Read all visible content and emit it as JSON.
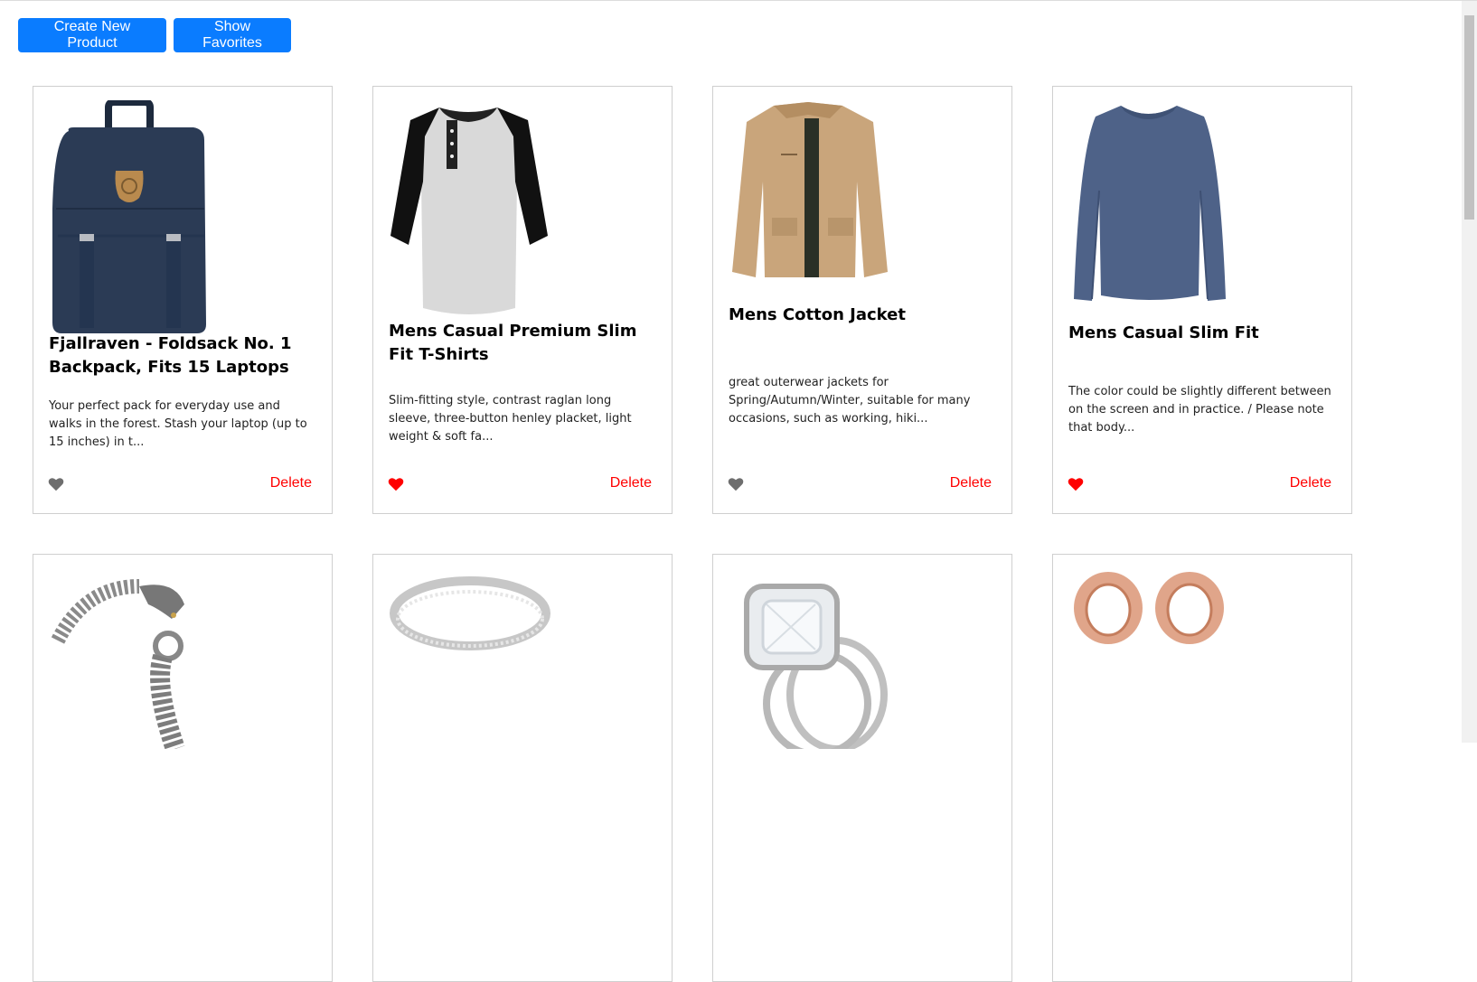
{
  "toolbar": {
    "create_label": "Create New Product",
    "favorites_label": "Show Favorites"
  },
  "colors": {
    "primary": "#0a7cff",
    "delete": "#ff0000",
    "favorite_on": "#ff0000",
    "favorite_off": "#6e6e6e"
  },
  "products": [
    {
      "title": "Fjallraven - Foldsack No. 1 Backpack, Fits 15 Laptops",
      "description": "Your perfect pack for everyday use and walks in the forest. Stash your laptop (up to 15 inches) in t...",
      "favorite": false,
      "delete_label": "Delete",
      "image_icon": "backpack-image"
    },
    {
      "title": "Mens Casual Premium Slim Fit T-Shirts",
      "description": "Slim-fitting style, contrast raglan long sleeve, three-button henley placket, light weight & soft fa...",
      "favorite": true,
      "delete_label": "Delete",
      "image_icon": "tshirt-image"
    },
    {
      "title": "Mens Cotton Jacket",
      "description": "great outerwear jackets for Spring/Autumn/Winter, suitable for many occasions, such as working, hiki...",
      "favorite": false,
      "delete_label": "Delete",
      "image_icon": "jacket-image"
    },
    {
      "title": "Mens Casual Slim Fit",
      "description": "The color could be slightly different between on the screen and in practice. / Please note that body...",
      "favorite": true,
      "delete_label": "Delete",
      "image_icon": "longsleeve-image"
    },
    {
      "image_icon": "bracelet-image"
    },
    {
      "image_icon": "ring-image"
    },
    {
      "image_icon": "engagement-ring-image"
    },
    {
      "image_icon": "ear-tunnels-image"
    }
  ]
}
